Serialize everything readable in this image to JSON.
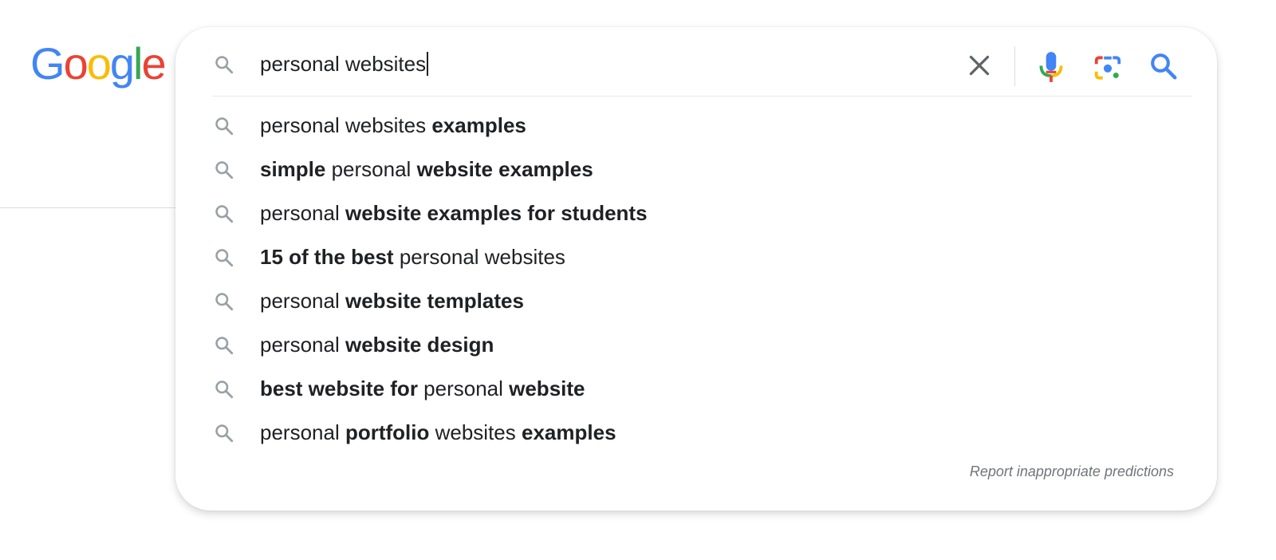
{
  "logo": {
    "letters": [
      {
        "char": "G",
        "color": "#4285F4"
      },
      {
        "char": "o",
        "color": "#EA4335"
      },
      {
        "char": "o",
        "color": "#FBBC05"
      },
      {
        "char": "g",
        "color": "#4285F4"
      },
      {
        "char": "l",
        "color": "#34A853"
      },
      {
        "char": "e",
        "color": "#EA4335"
      }
    ]
  },
  "search": {
    "query": "personal websites",
    "icons": {
      "left": "search-icon",
      "clear": "close-icon",
      "voice": "microphone-icon",
      "lens": "camera-lens-icon",
      "submit": "search-icon"
    },
    "colors": {
      "accent": "#4285F4",
      "red": "#EA4335",
      "yellow": "#FBBC05",
      "green": "#34A853"
    }
  },
  "suggestions": [
    {
      "segments": [
        {
          "text": "personal websites ",
          "bold": false
        },
        {
          "text": "examples",
          "bold": true
        }
      ]
    },
    {
      "segments": [
        {
          "text": "simple",
          "bold": true
        },
        {
          "text": " personal ",
          "bold": false
        },
        {
          "text": "website examples",
          "bold": true
        }
      ]
    },
    {
      "segments": [
        {
          "text": "personal ",
          "bold": false
        },
        {
          "text": "website examples for students",
          "bold": true
        }
      ]
    },
    {
      "segments": [
        {
          "text": "15 of the best",
          "bold": true
        },
        {
          "text": " personal websites",
          "bold": false
        }
      ]
    },
    {
      "segments": [
        {
          "text": "personal ",
          "bold": false
        },
        {
          "text": "website templates",
          "bold": true
        }
      ]
    },
    {
      "segments": [
        {
          "text": "personal ",
          "bold": false
        },
        {
          "text": "website design",
          "bold": true
        }
      ]
    },
    {
      "segments": [
        {
          "text": "best website for",
          "bold": true
        },
        {
          "text": " personal ",
          "bold": false
        },
        {
          "text": "website",
          "bold": true
        }
      ]
    },
    {
      "segments": [
        {
          "text": "personal ",
          "bold": false
        },
        {
          "text": "portfolio",
          "bold": true
        },
        {
          "text": " websites ",
          "bold": false
        },
        {
          "text": "examples",
          "bold": true
        }
      ]
    }
  ],
  "footer": {
    "report_label": "Report inappropriate predictions"
  }
}
